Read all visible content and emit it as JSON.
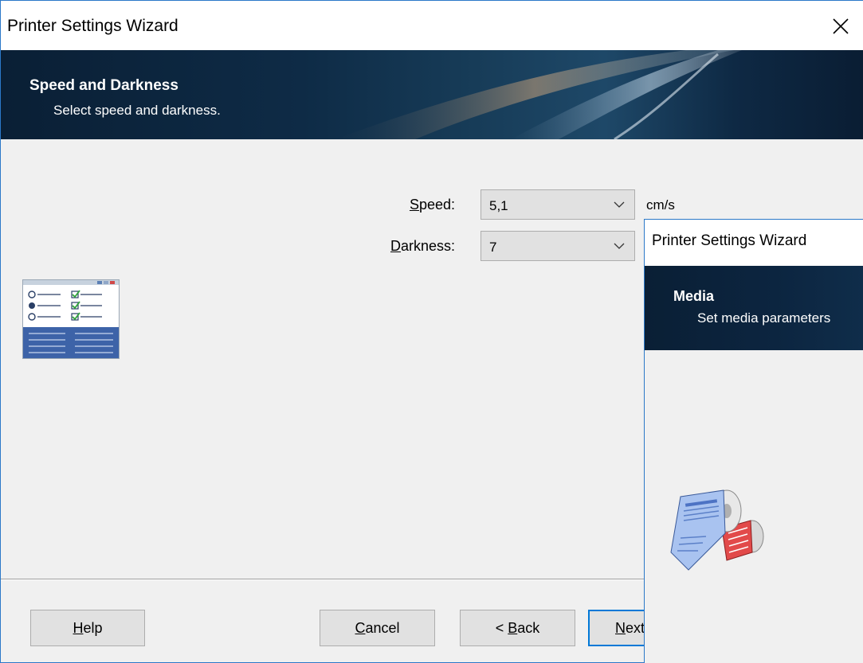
{
  "window": {
    "title": "Printer Settings Wizard"
  },
  "banner": {
    "title": "Speed and Darkness",
    "subtitle": "Select speed and darkness."
  },
  "speed": {
    "label_accel": "S",
    "label_rest": "peed:",
    "value": "5,1",
    "unit": "cm/s"
  },
  "darkness": {
    "label_accel": "D",
    "label_rest": "arkness:",
    "value": "7"
  },
  "buttons": {
    "help_accel": "H",
    "help_rest": "elp",
    "cancel_accel": "C",
    "cancel_rest": "ancel",
    "back_prefix": "< ",
    "back_accel": "B",
    "back_rest": "ack",
    "next_accel": "N",
    "next_rest": "ext >"
  },
  "overlay_window": {
    "title": "Printer Settings Wizard",
    "banner_title": "Media",
    "banner_subtitle": "Set media parameters"
  },
  "icons": {
    "close": "close-icon",
    "dropdown": "chevron-down-icon",
    "page": "settings-list-icon",
    "media": "label-roll-icon"
  },
  "colors": {
    "accent": "#0078d7",
    "banner_dark": "#0a1f35"
  }
}
